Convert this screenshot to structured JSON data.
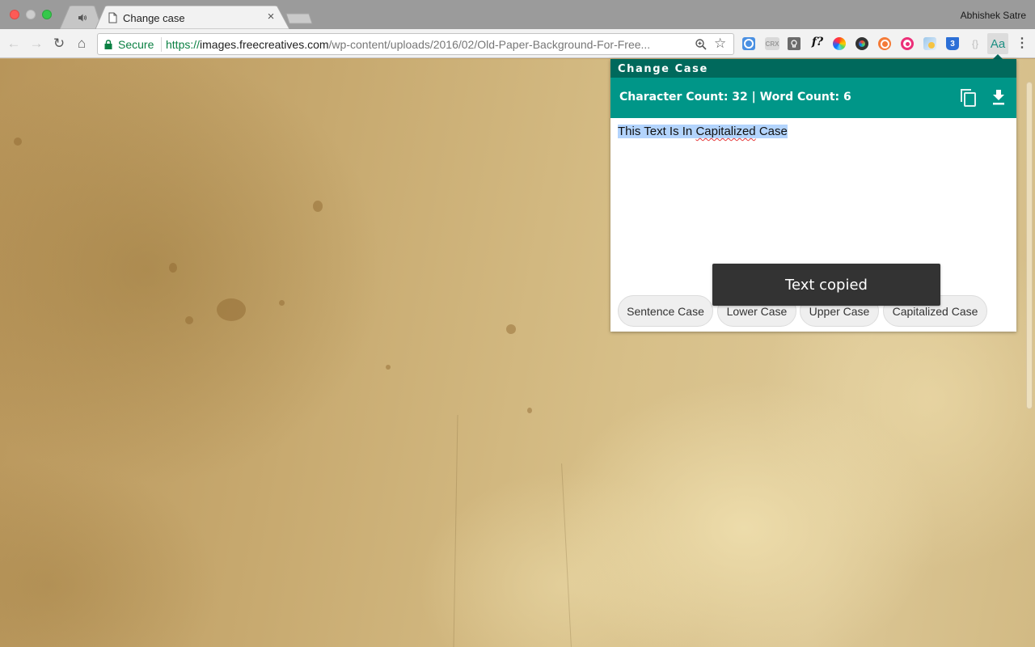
{
  "browser": {
    "profile_name": "Abhishek Satre",
    "tabs": [
      {
        "title": "",
        "icon": "speaker-icon",
        "active": false
      },
      {
        "title": "Change case",
        "icon": "page-icon",
        "active": true
      }
    ],
    "close_tab_glyph": "×",
    "toolbar": {
      "back_glyph": "←",
      "forward_glyph": "→",
      "reload_glyph": "↻",
      "home_glyph": "⌂",
      "secure_label": "Secure",
      "url_scheme": "https://",
      "url_host": "images.freecreatives.com",
      "url_path": "/wp-content/uploads/2016/02/Old-Paper-Background-For-Free...",
      "star_glyph": "☆",
      "menu_glyph": "⋮"
    },
    "extensions": [
      {
        "name": "settings-extension",
        "label": ""
      },
      {
        "name": "crx-extension",
        "label": "CRX"
      },
      {
        "name": "lightbulb-extension",
        "label": "💡"
      },
      {
        "name": "whatfont-extension",
        "label": "f?"
      },
      {
        "name": "color-picker-extension",
        "label": ""
      },
      {
        "name": "color-dark-extension",
        "label": ""
      },
      {
        "name": "orange-extension",
        "label": ""
      },
      {
        "name": "eye-extension",
        "label": ""
      },
      {
        "name": "image-extension",
        "label": ""
      },
      {
        "name": "css3-extension",
        "label": "3"
      },
      {
        "name": "json-extension",
        "label": "{}"
      },
      {
        "name": "change-case-extension",
        "label": "Aa"
      }
    ]
  },
  "popup": {
    "title": "Change Case",
    "stats": "Character Count: 32 | Word Count: 6",
    "text_selected_before": "This Text Is In ",
    "text_misspelled": "Capitalized",
    "text_selected_after": " Case",
    "buttons": [
      {
        "label": "Sentence Case"
      },
      {
        "label": "Lower Case"
      },
      {
        "label": "Upper Case"
      },
      {
        "label": "Capitalized Case"
      }
    ],
    "toast": "Text copied",
    "colors": {
      "header": "#00695c",
      "stats_bar": "#009688",
      "selection": "#b3d4fd",
      "toast": "#333333"
    }
  }
}
